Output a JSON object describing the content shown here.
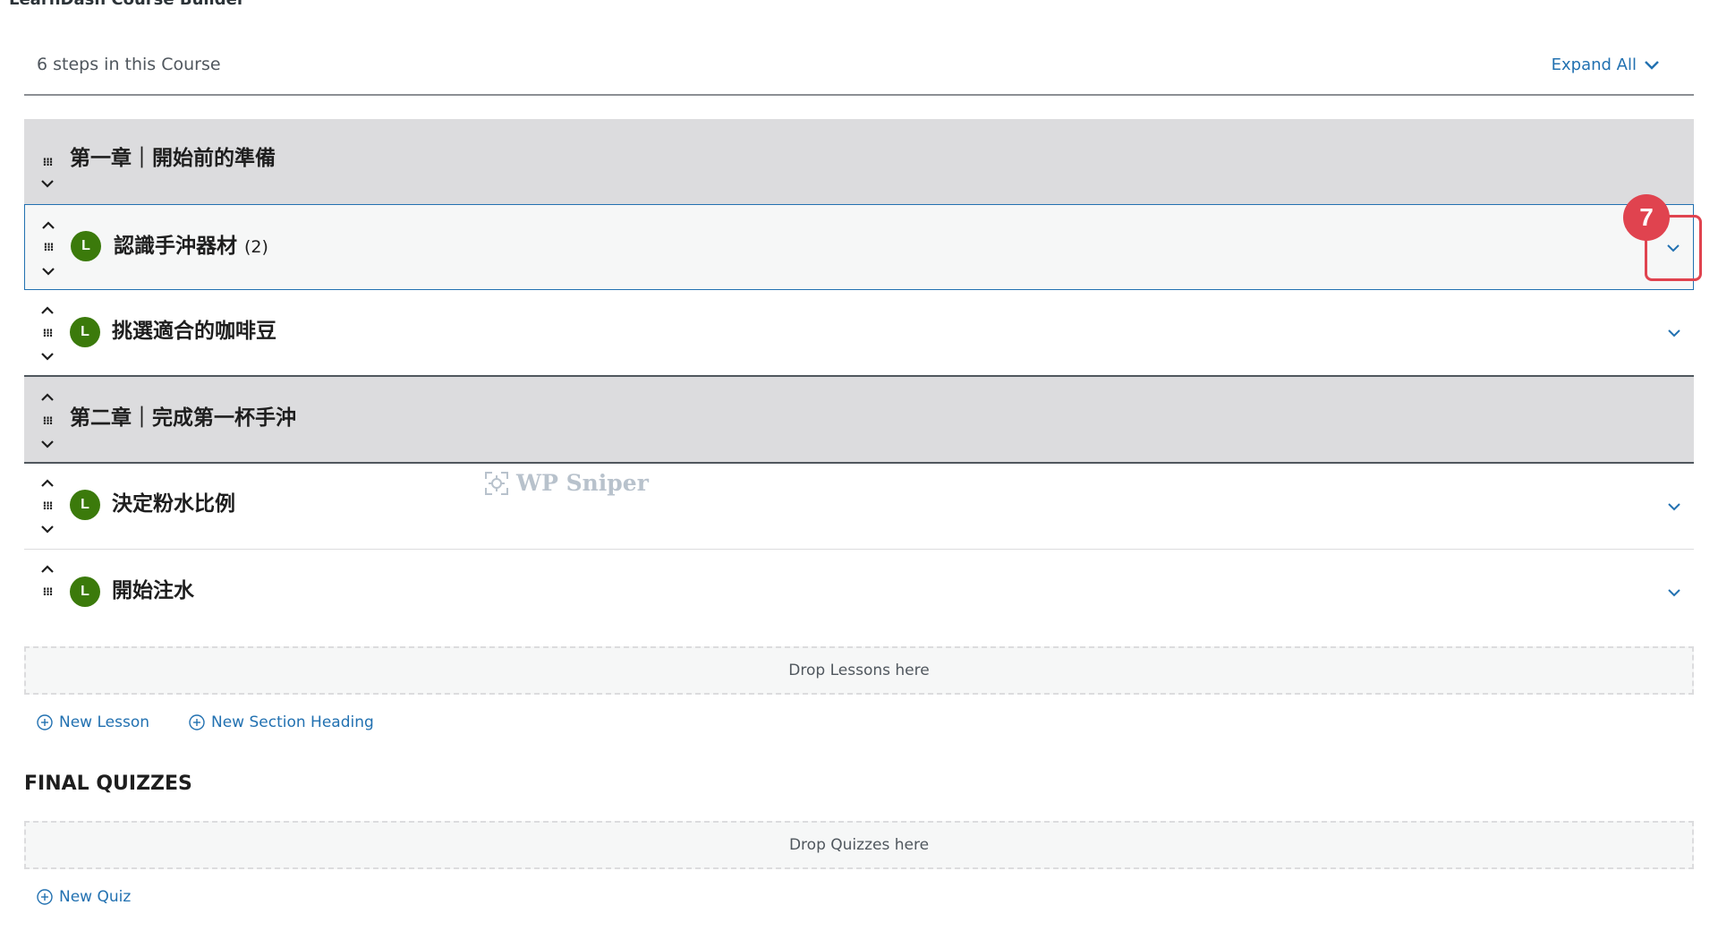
{
  "page": {
    "title": "LearnDash Course Builder"
  },
  "builder": {
    "steps_text": "6 steps in this Course",
    "expand_all_label": "Expand All",
    "rows": [
      {
        "type": "section",
        "title": "第一章｜開始前的準備"
      },
      {
        "type": "lesson",
        "badge": "L",
        "title": "認識手沖器材",
        "count": "(2)",
        "active": true
      },
      {
        "type": "lesson",
        "badge": "L",
        "title": "挑選適合的咖啡豆"
      },
      {
        "type": "section",
        "title": "第二章｜完成第一杯手沖"
      },
      {
        "type": "lesson",
        "badge": "L",
        "title": "決定粉水比例"
      },
      {
        "type": "lesson",
        "badge": "L",
        "title": "開始注水"
      }
    ],
    "drop_lessons": "Drop Lessons here",
    "new_lesson_label": "New Lesson",
    "new_section_heading_label": "New Section Heading"
  },
  "final_quizzes": {
    "heading": "FINAL QUIZZES",
    "drop_quizzes": "Drop Quizzes here",
    "new_quiz_label": "New Quiz"
  },
  "annotation": {
    "number": "7",
    "color": "#e0434f"
  },
  "watermark": {
    "text": "WP Sniper"
  },
  "colors": {
    "link": "#2271b1",
    "section_bg": "#dcdcde",
    "lesson_badge": "#3b7a0b",
    "active_border": "#2271b1"
  }
}
